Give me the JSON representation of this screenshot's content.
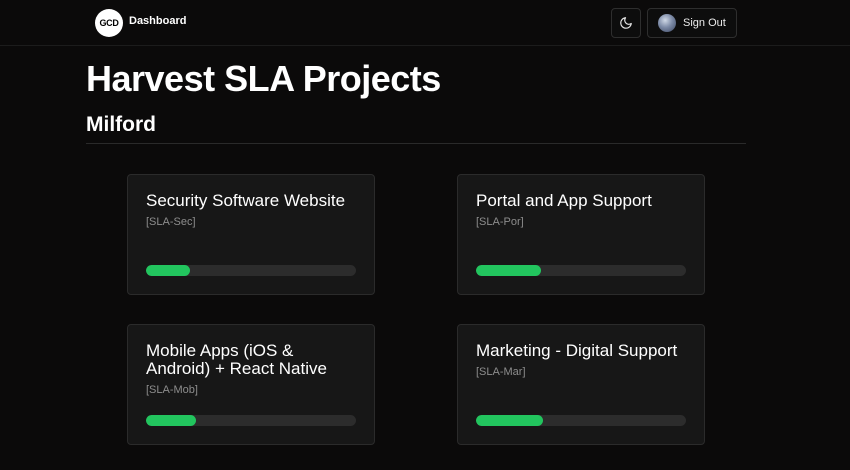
{
  "header": {
    "logo_text": "GCD",
    "nav_label": "Dashboard",
    "theme_icon": "moon-icon",
    "signout_label": "Sign Out"
  },
  "page": {
    "title": "Harvest SLA Projects",
    "subtitle": "Milford"
  },
  "projects": [
    {
      "title": "Security Software Website",
      "code": "[SLA-Sec]",
      "progress_percent": 21
    },
    {
      "title": "Portal and App Support",
      "code": "[SLA-Por]",
      "progress_percent": 31
    },
    {
      "title": "Mobile Apps (iOS & Android) + React Native",
      "code": "[SLA-Mob]",
      "progress_percent": 24
    },
    {
      "title": "Marketing - Digital Support",
      "code": "[SLA-Mar]",
      "progress_percent": 32
    }
  ],
  "colors": {
    "background": "#0b0a0a",
    "card": "#171717",
    "progress": "#22c55e",
    "track": "#2c2c2c"
  }
}
